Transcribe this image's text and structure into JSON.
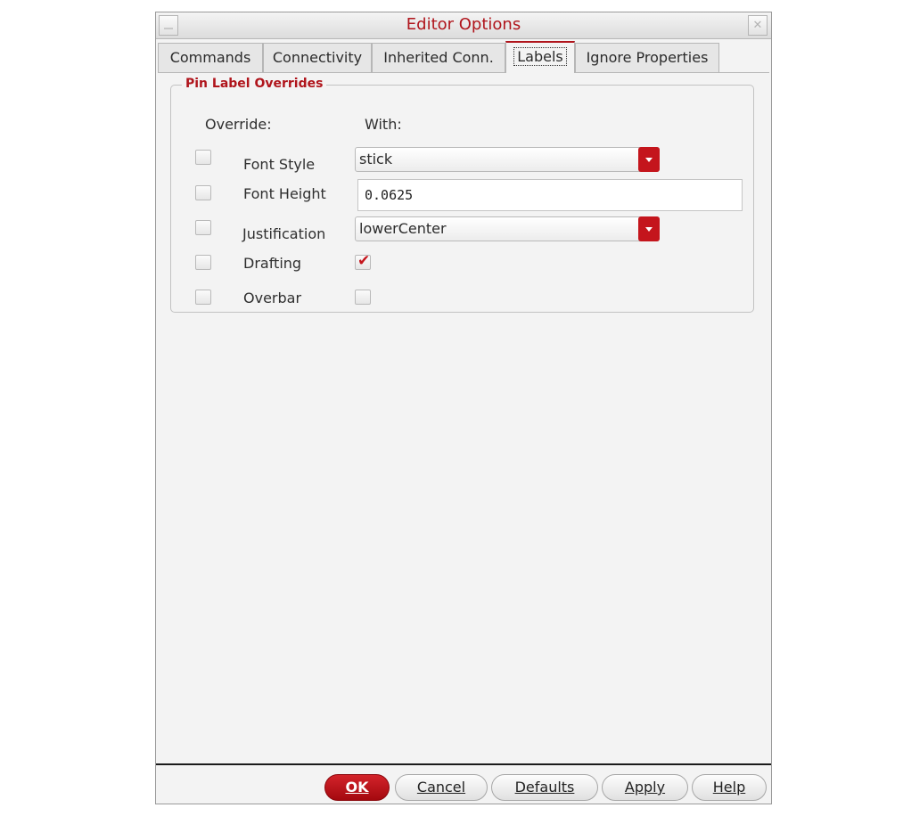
{
  "window": {
    "title": "Editor Options",
    "minimize_glyph": "–",
    "close_glyph": "✕"
  },
  "tabs": [
    {
      "label": "Commands",
      "active": false
    },
    {
      "label": "Connectivity",
      "active": false
    },
    {
      "label": "Inherited Conn.",
      "active": false
    },
    {
      "label": "Labels",
      "active": true
    },
    {
      "label": "Ignore Properties",
      "active": false
    }
  ],
  "group": {
    "title": "Pin Label Overrides",
    "override_header": "Override:",
    "with_header": "With:",
    "rows": [
      {
        "label": "Font Style",
        "override": false,
        "control": "select",
        "value": "stick"
      },
      {
        "label": "Font Height",
        "override": false,
        "control": "input",
        "value": "0.0625"
      },
      {
        "label": "Justification",
        "override": false,
        "control": "select",
        "value": "lowerCenter"
      },
      {
        "label": "Drafting",
        "override": false,
        "control": "checkbox",
        "checked": true
      },
      {
        "label": "Overbar",
        "override": false,
        "control": "checkbox",
        "checked": false
      }
    ]
  },
  "buttons": {
    "ok": "OK",
    "cancel": "Cancel",
    "defaults": "Defaults",
    "apply": "Apply",
    "help": "Help"
  },
  "colors": {
    "accent": "#b0151c",
    "dropdown_arrow": "#c4151c",
    "panel_bg": "#f3f3f3"
  },
  "icons": {
    "check": "✔"
  }
}
